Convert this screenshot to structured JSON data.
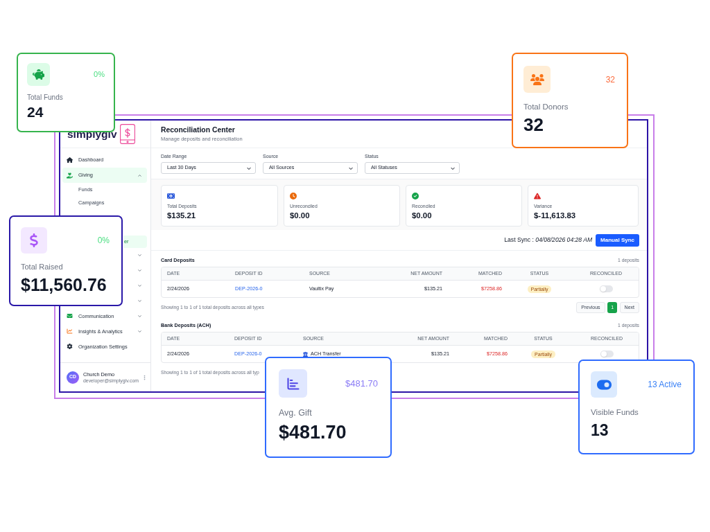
{
  "sidebar": {
    "logo": "simplygiv",
    "items": [
      {
        "kind": "link",
        "label": "Dashboard",
        "selected": false
      },
      {
        "kind": "group",
        "label": "Giving",
        "selected": true,
        "expanded": true,
        "children": [
          {
            "label": "Funds",
            "selected": false
          },
          {
            "label": "Campaigns",
            "selected": false
          },
          {
            "label": "er",
            "selected": true
          }
        ]
      },
      {
        "kind": "group",
        "expanded": false
      },
      {
        "kind": "group",
        "expanded": false
      },
      {
        "kind": "group",
        "expanded": false
      },
      {
        "kind": "group",
        "expanded": false
      },
      {
        "kind": "group",
        "label": "Communication",
        "selected": false,
        "expanded": false
      },
      {
        "kind": "group",
        "label": "Insights & Analytics",
        "selected": false,
        "expanded": false
      },
      {
        "kind": "link",
        "label": "Organization Settings",
        "selected": false
      }
    ],
    "user": {
      "initials": "CD",
      "name": "Church Demo",
      "email": "developer@simplygiv.com"
    }
  },
  "header": {
    "title": "Reconciliation Center",
    "subtitle": "Manage deposits and reconciliation"
  },
  "filters": [
    {
      "label": "Date Range",
      "value": "Last 30 Days"
    },
    {
      "label": "Source",
      "value": "All Sources"
    },
    {
      "label": "Status",
      "value": "All Statuses"
    }
  ],
  "summary_cards": [
    {
      "label": "Total Deposits",
      "value": "$135.21"
    },
    {
      "label": "Unreconciled",
      "value": "$0.00"
    },
    {
      "label": "Reconciled",
      "value": "$0.00"
    },
    {
      "label": "Variance",
      "value": "$-11,613.83"
    }
  ],
  "sync": {
    "text": "Last Sync : *04/08/2026 04:28 AM*",
    "button": "Manual Sync"
  },
  "deposit_tables": [
    {
      "kind": "card",
      "title": "Card Deposits",
      "count": "1 deposits",
      "columns": [
        "DATE",
        "DEPOSIT ID",
        "SOURCE",
        "NET AMOUNT",
        "MATCHED",
        "STATUS",
        "RECONCILED"
      ],
      "rows": [
        {
          "date": "2/24/2026",
          "deposit_id": "DEP-2026-0",
          "source": "Vaultix Pay",
          "net_amount": "$135.21",
          "matched": "$7258.86",
          "status": "Partially",
          "reconciled": false
        }
      ],
      "footer": "Showing 1 to 1 of 1 total deposits across all types",
      "pagination": {
        "previous": "Previous",
        "pages": [
          {
            "label": "1",
            "selected": true
          }
        ],
        "next": "Next"
      }
    },
    {
      "kind": "ach",
      "title": "Bank Deposits (ACH)",
      "count": "1 deposits",
      "columns": [
        "DATE",
        "DEPOSIT ID",
        "SOURCE",
        "NET AMOUNT",
        "MATCHED",
        "STATUS",
        "RECONCILED"
      ],
      "rows": [
        {
          "date": "2/24/2026",
          "deposit_id": "DEP-2026-0",
          "source": "ACH Transfer",
          "net_amount": "$135.21",
          "matched": "$7258.86",
          "status": "Partially",
          "reconciled": false
        }
      ],
      "footer": "Showing 1 to 1 of 1 total deposits across all typ"
    }
  ],
  "floating_cards": [
    {
      "label": "Total Funds",
      "value": "24",
      "trend": "0%"
    },
    {
      "label": "Total Donors",
      "value": "32",
      "trend": "32"
    },
    {
      "label": "Total Raised",
      "value": "$11,560.76",
      "trend": "0%"
    },
    {
      "label": "Avg. Gift",
      "value": "$481.70",
      "trend": "$481.70"
    },
    {
      "label": "Visible Funds",
      "value": "13",
      "trend": "13 Active"
    }
  ]
}
